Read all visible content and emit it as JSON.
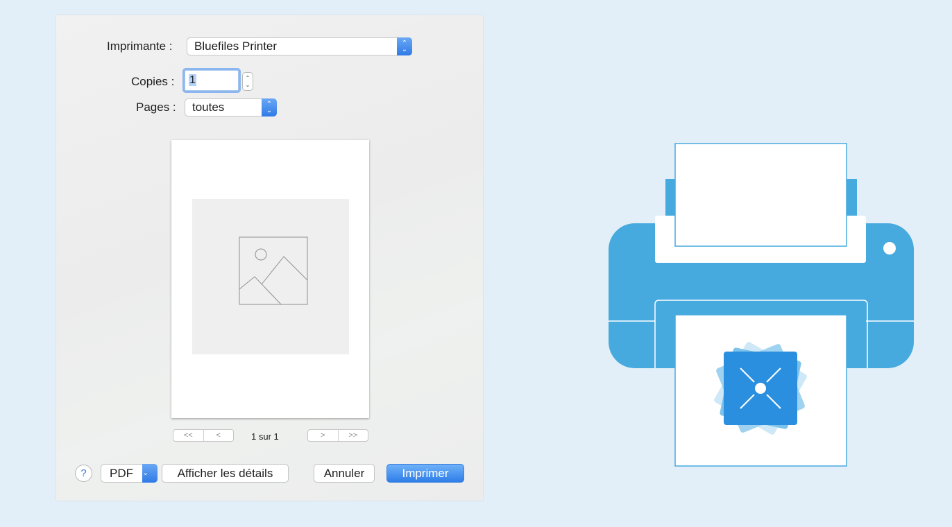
{
  "dialog": {
    "printer": {
      "label": "Imprimante :",
      "value": "Bluefiles Printer"
    },
    "copies": {
      "label": "Copies :",
      "value": "1"
    },
    "pages": {
      "label": "Pages :",
      "value": "toutes"
    },
    "pager": {
      "first": "<<",
      "prev": "<",
      "next": ">",
      "last": ">>",
      "status": "1 sur 1"
    },
    "footer": {
      "help": "?",
      "pdf": "PDF",
      "details": "Afficher les détails",
      "cancel": "Annuler",
      "print": "Imprimer"
    }
  },
  "colors": {
    "accent": "#2f7ae6",
    "printer_blue": "#47aadf",
    "background": "#e3eff8"
  },
  "icons": {
    "popup_arrows": "up-down-arrows-icon",
    "image_placeholder": "image-placeholder-icon",
    "printer_illustration": "printer-icon"
  }
}
